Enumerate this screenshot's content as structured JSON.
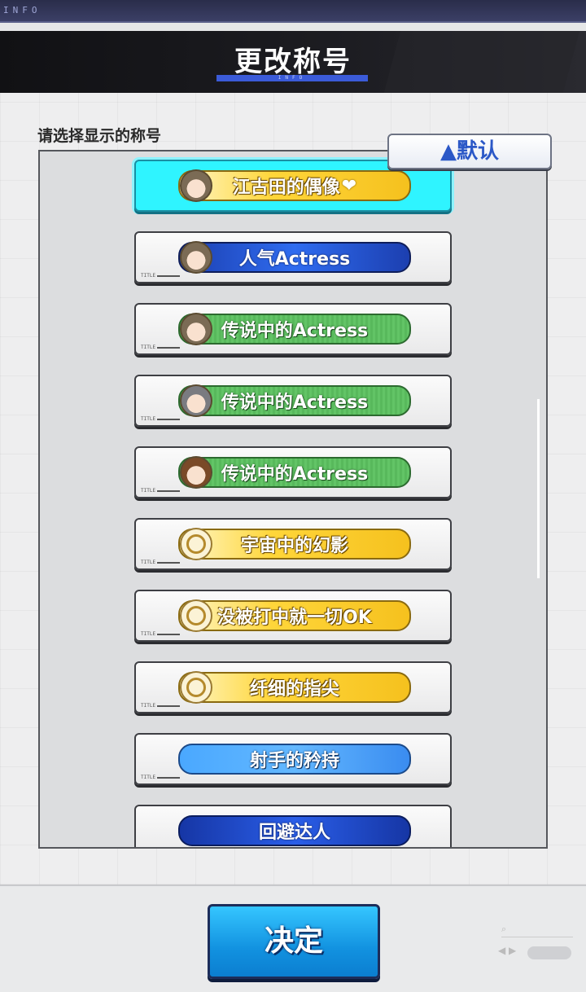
{
  "topbar": {
    "info_label": "INFO"
  },
  "header": {
    "title": "更改称号",
    "subtitle": "INFO"
  },
  "panel": {
    "prompt": "请选择显示的称号",
    "sort_button": "▲默认"
  },
  "titles": [
    {
      "label": "江古田的偶像",
      "style": "gold",
      "emblem": "face",
      "selected": true,
      "suffix": "❤"
    },
    {
      "label": "人气Actress",
      "style": "blue",
      "emblem": "face"
    },
    {
      "label": "传说中的Actress",
      "style": "green",
      "emblem": "face"
    },
    {
      "label": "传说中的Actress",
      "style": "green",
      "emblem": "face-gray"
    },
    {
      "label": "传说中的Actress",
      "style": "green",
      "emblem": "face-brown"
    },
    {
      "label": "宇宙中的幻影",
      "style": "gold",
      "emblem": "gear"
    },
    {
      "label": "没被打中就一切OK",
      "style": "gold",
      "emblem": "gear"
    },
    {
      "label": "纤细的指尖",
      "style": "gold",
      "emblem": "gear"
    },
    {
      "label": "射手的矜持",
      "style": "lightblue",
      "emblem": "none"
    },
    {
      "label": "回避达人",
      "style": "royal",
      "emblem": "none"
    }
  ],
  "card_tag": "TITLE",
  "footer": {
    "confirm_button": "决定"
  }
}
